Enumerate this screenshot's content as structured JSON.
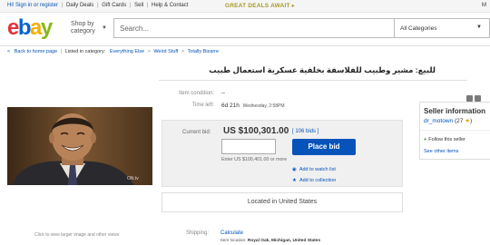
{
  "topbar": {
    "greeting": "Hi! Sign in or register",
    "links": [
      "Daily Deals",
      "Gift Cards",
      "Sell",
      "Help & Contact"
    ],
    "promo": "GREAT DEALS AWAIT ▸",
    "right_letter": "M"
  },
  "header": {
    "logo_letters": [
      {
        "char": "e",
        "color": "#e53238"
      },
      {
        "char": "b",
        "color": "#0064d2"
      },
      {
        "char": "a",
        "color": "#f5af02"
      },
      {
        "char": "y",
        "color": "#86b817"
      }
    ],
    "shop_by": "Shop by",
    "category": "category",
    "search_placeholder": "Search...",
    "category_select": "All Categories"
  },
  "breadcrumb": {
    "back": "Back to home page",
    "listed_in": "Listed in category:",
    "items": [
      "Everything Else",
      "Weird Stuff",
      "Totally Bizarre"
    ]
  },
  "item": {
    "title": "للبيع: مشير وطبيب للفلاسفة بخلفية عسكرية استعمال طبيب",
    "condition_label": "Item condition:",
    "condition_value": "--",
    "time_left_label": "Time left:",
    "time_left_value": "6d 21h",
    "time_left_detail": "Wednesday, 2:58PM",
    "current_bid_label": "Current bid:",
    "current_bid": "US $100,301.00",
    "bids": "[ 106 bids ]",
    "place_bid": "Place bid",
    "enter_text": "Enter US $100,401.00 or more",
    "watch_list": "Add to watch list",
    "collection": "Add to collection",
    "located": "Located in United States",
    "shipping_label": "Shipping:",
    "shipping_value": "Calculate",
    "item_location_label": "Item location:",
    "item_location_value": "Royal Oak, Michigan, United States",
    "image_caption": "Click to view larger image and other views",
    "image_watermark": "ON.tv"
  },
  "seller": {
    "heading": "Seller information",
    "name": "dr_motown",
    "score": "(27",
    "score_end": ")",
    "follow": "Follow this seller",
    "see_other": "See other items"
  }
}
